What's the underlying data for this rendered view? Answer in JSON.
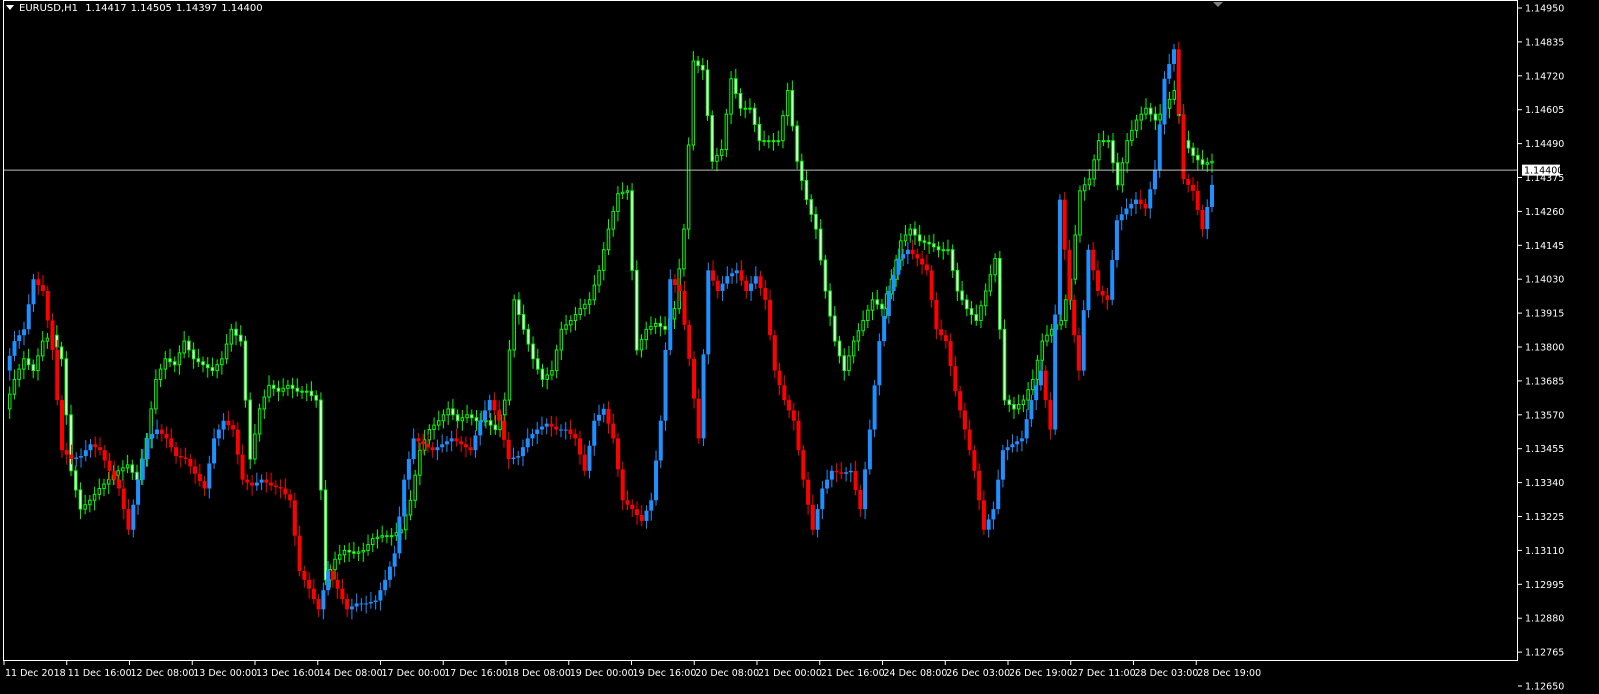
{
  "header": {
    "symbol": "EURUSD,H1",
    "open": "1.14417",
    "high": "1.14505",
    "low": "1.14397",
    "close": "1.14400"
  },
  "colors": {
    "background": "#000000",
    "bull": "#1e90ff",
    "bear": "#ff0000",
    "overlay": "#00ff00",
    "overlay_bear_fill": "#ffffff",
    "grid_frame": "#ffffff",
    "price_line": "#c0c0c0"
  },
  "chart_data": {
    "type": "candlestick",
    "title": "EURUSD,H1",
    "current_price": 1.144,
    "current_price_label": "1.14400",
    "ylim": [
      1.1265,
      1.1495
    ],
    "y_ticks": [
      "1.14950",
      "1.14835",
      "1.14720",
      "1.14605",
      "1.14490",
      "1.14375",
      "1.14260",
      "1.14145",
      "1.14030",
      "1.13915",
      "1.13800",
      "1.13685",
      "1.13570",
      "1.13455",
      "1.13340",
      "1.13225",
      "1.13110",
      "1.12995",
      "1.12880",
      "1.12765",
      "1.12650"
    ],
    "x_ticks": [
      "11 Dec 2018",
      "11 Dec 16:00",
      "12 Dec 08:00",
      "13 Dec 00:00",
      "13 Dec 16:00",
      "14 Dec 08:00",
      "17 Dec 00:00",
      "17 Dec 16:00",
      "18 Dec 08:00",
      "19 Dec 00:00",
      "19 Dec 16:00",
      "20 Dec 08:00",
      "21 Dec 00:00",
      "21 Dec 16:00",
      "24 Dec 08:00",
      "26 Dec 03:00",
      "26 Dec 19:00",
      "27 Dec 11:00",
      "28 Dec 03:00",
      "28 Dec 19:00"
    ],
    "grid": false,
    "series": [
      {
        "style": "red-blue candles",
        "closes": [
          1.1372,
          1.1382,
          1.1386,
          1.1403,
          1.1399,
          1.1379,
          1.1345,
          1.1342,
          1.1343,
          1.1347,
          1.1345,
          1.1338,
          1.1332,
          1.1318,
          1.1335,
          1.1349,
          1.1352,
          1.1349,
          1.1343,
          1.1342,
          1.1337,
          1.1332,
          1.1349,
          1.1355,
          1.1352,
          1.1335,
          1.1333,
          1.1335,
          1.1333,
          1.1332,
          1.1328,
          1.1304,
          1.1298,
          1.1291,
          1.1304,
          1.1298,
          1.1291,
          1.1293,
          1.1293,
          1.1294,
          1.1301,
          1.131,
          1.1335,
          1.1349,
          1.1347,
          1.1345,
          1.1347,
          1.1349,
          1.1347,
          1.1345,
          1.1355,
          1.1362,
          1.1355,
          1.1342,
          1.1343,
          1.1349,
          1.1352,
          1.1354,
          1.1352,
          1.1352,
          1.1349,
          1.1338,
          1.1355,
          1.1359,
          1.1349,
          1.1328,
          1.1325,
          1.1321,
          1.1328,
          1.1355,
          1.1403,
          1.1399,
          1.1376,
          1.1349,
          1.1406,
          1.1399,
          1.1404,
          1.1406,
          1.1399,
          1.1404,
          1.1396,
          1.1372,
          1.1362,
          1.1355,
          1.1335,
          1.1318,
          1.1332,
          1.1338,
          1.1337,
          1.1338,
          1.1325,
          1.1352,
          1.1382,
          1.1399,
          1.141,
          1.1413,
          1.141,
          1.1406,
          1.1386,
          1.1382,
          1.1365,
          1.1352,
          1.1338,
          1.1318,
          1.1325,
          1.1345,
          1.1347,
          1.1349,
          1.1362,
          1.1372,
          1.1352,
          1.143,
          1.1396,
          1.1372,
          1.1413,
          1.1399,
          1.1396,
          1.1423,
          1.1427,
          1.143,
          1.1427,
          1.144,
          1.1471,
          1.1481,
          1.1437,
          1.1433,
          1.142,
          1.1435
        ]
      },
      {
        "style": "green candles",
        "closes": [
          1.1359,
          1.1369,
          1.1376,
          1.1372,
          1.1382,
          1.1384,
          1.1376,
          1.1338,
          1.1325,
          1.1328,
          1.1332,
          1.1335,
          1.1338,
          1.134,
          1.1335,
          1.1349,
          1.1369,
          1.1376,
          1.1374,
          1.1382,
          1.1376,
          1.1374,
          1.1372,
          1.1376,
          1.1386,
          1.1382,
          1.1342,
          1.1359,
          1.1367,
          1.1365,
          1.1367,
          1.1365,
          1.1365,
          1.1362,
          1.1301,
          1.1308,
          1.1311,
          1.131,
          1.1311,
          1.1315,
          1.1316,
          1.1316,
          1.1318,
          1.1328,
          1.1345,
          1.1352,
          1.1355,
          1.1359,
          1.1355,
          1.1357,
          1.1355,
          1.1355,
          1.1352,
          1.1362,
          1.1396,
          1.1386,
          1.1376,
          1.1369,
          1.1372,
          1.1386,
          1.1389,
          1.1393,
          1.1396,
          1.1406,
          1.142,
          1.1432,
          1.1433,
          1.1379,
          1.1386,
          1.1388,
          1.1386,
          1.1393,
          1.142,
          1.1477,
          1.1474,
          1.1443,
          1.1447,
          1.1471,
          1.1461,
          1.1461,
          1.145,
          1.145,
          1.145,
          1.1467,
          1.1443,
          1.143,
          1.142,
          1.1399,
          1.1382,
          1.1372,
          1.1382,
          1.1389,
          1.1396,
          1.1393,
          1.1403,
          1.1416,
          1.142,
          1.1416,
          1.1415,
          1.1413,
          1.1413,
          1.1399,
          1.1393,
          1.1389,
          1.1399,
          1.141,
          1.1362,
          1.1359,
          1.1362,
          1.1369,
          1.1382,
          1.1386,
          1.1389,
          1.1403,
          1.1433,
          1.1437,
          1.145,
          1.145,
          1.1435,
          1.145,
          1.1457,
          1.1461,
          1.1457,
          1.1461,
          1.1467,
          1.145,
          1.1445,
          1.1442,
          1.1443
        ]
      }
    ]
  }
}
